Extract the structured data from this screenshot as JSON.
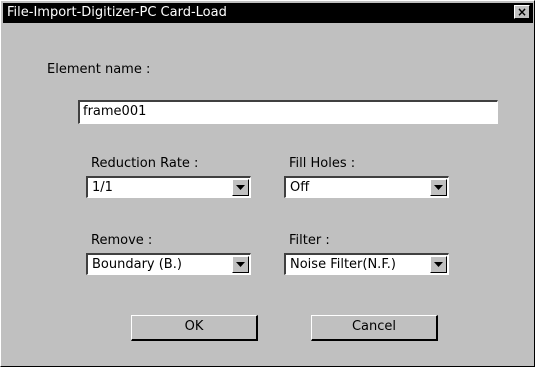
{
  "window": {
    "title": "File-Import-Digitizer-PC Card-Load",
    "close_icon": "close-icon",
    "close_glyph": "×"
  },
  "element_name": {
    "label": "Element name :",
    "value": "frame001"
  },
  "reduction_rate": {
    "label": "Reduction Rate :",
    "value": "1/1"
  },
  "fill_holes": {
    "label": "Fill Holes :",
    "value": "Off"
  },
  "remove": {
    "label": "Remove :",
    "value": "Boundary (B.)"
  },
  "filter": {
    "label": "Filter :",
    "value": "Noise Filter(N.F.)"
  },
  "buttons": {
    "ok": "OK",
    "cancel": "Cancel"
  }
}
